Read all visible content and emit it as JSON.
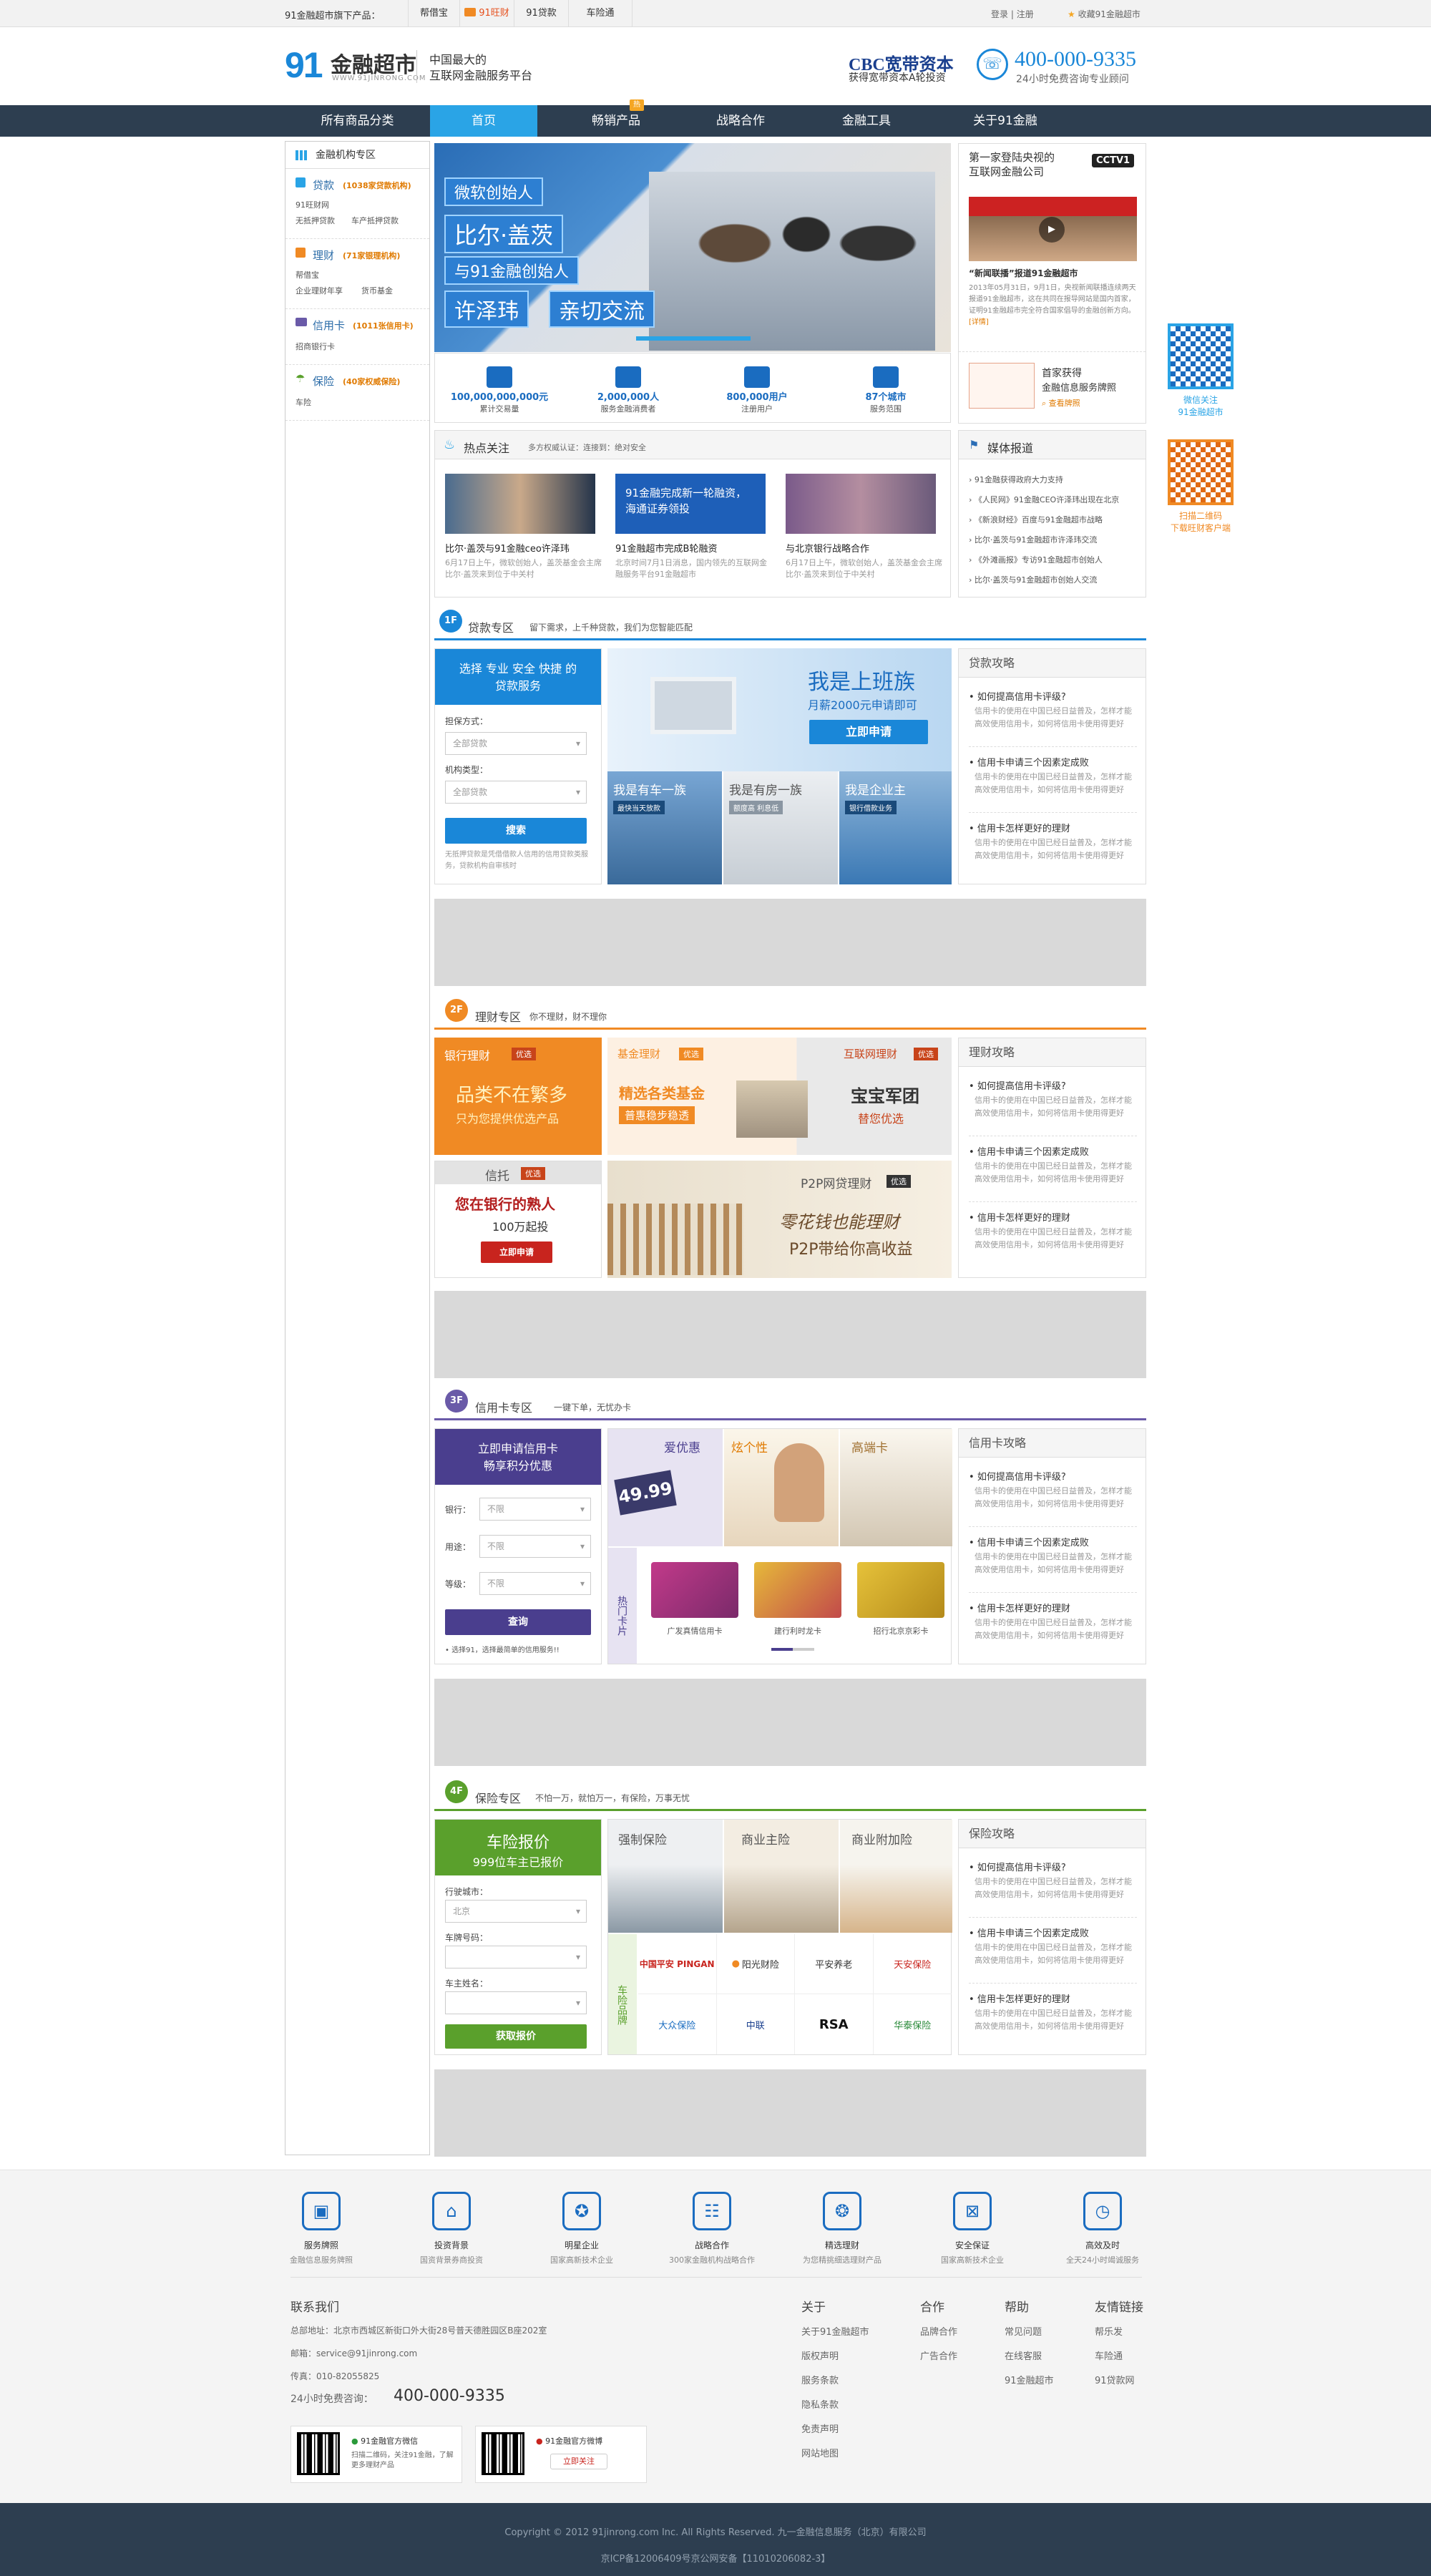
{
  "topbar": {
    "label": "91金融超市旗下产品：",
    "items": [
      "帮借宝",
      "91旺财",
      "91贷款",
      "车险通"
    ],
    "login": "登录",
    "sep": "|",
    "register": "注册",
    "fav": "收藏91金融超市"
  },
  "header": {
    "logo_num": "91",
    "logo_text": "金融超市",
    "logo_url": "WWW.91JINRONG.COM",
    "slogan_1": "中国最大的",
    "slogan_2": "互联网金融服务平台",
    "cbc": "CBC宽带资本",
    "cbc_sub": "获得宽带资本A轮投资",
    "phone": "400-000-9335",
    "phone_sub": "24小时免费咨询专业顾问"
  },
  "nav": {
    "items": [
      "所有商品分类",
      "首页",
      "畅销产品",
      "战略合作",
      "金融工具",
      "关于91金融"
    ],
    "hot_tag": "热"
  },
  "sidebar": {
    "title": "金融机构专区",
    "loan": {
      "title": "贷款",
      "note": "(1038家贷款机构)",
      "links": [
        "91旺财网",
        "无抵押贷款",
        "车产抵押贷款"
      ]
    },
    "finance": {
      "title": "理财",
      "note": "(71家银理机构)",
      "links": [
        "帮借宝",
        "企业理财年享",
        "货币基金"
      ]
    },
    "card": {
      "title": "信用卡",
      "note": "(1011张信用卡)",
      "links": [
        "招商银行卡"
      ]
    },
    "insurance": {
      "title": "保险",
      "note": "(40家权威保险)",
      "links": [
        "车险"
      ]
    }
  },
  "banner": {
    "l1": "微软创始人",
    "l2": "比尔·盖茨",
    "l3": "与91金融创始人",
    "l4": "许泽玮",
    "l5": "亲切交流"
  },
  "stats": [
    {
      "num": "100,000,000,000元",
      "lbl": "累计交易量"
    },
    {
      "num": "2,000,000人",
      "lbl": "服务金融消费者"
    },
    {
      "num": "800,000用户",
      "lbl": "注册用户"
    },
    {
      "num": "87个城市",
      "lbl": "服务范围"
    }
  ],
  "news_right": {
    "head1": "第一家登陆央视的",
    "head2": "互联网金融公司",
    "cctv": "CCTV1",
    "title": "“新闻联播”报道91金融超市",
    "body": "2013年05月31日，9月1日，央视新闻联播连续两天报道91金融超市，这在共同在报导网站是国内首家，证明91金融超市完全符合国家倡导的金融创新方向。",
    "more": "[详情]",
    "promo1": "首家获得",
    "promo2": "金融信息服务牌照",
    "promo_link": "查看牌照"
  },
  "hot": {
    "title": "热点关注",
    "tags": "多方权威认证：连接到：绝对安全",
    "cards": [
      {
        "t": "比尔·盖茨与91金融ceo许泽玮",
        "d": "6月17日上午，微软创始人，盖茨基金会主席比尔·盖茨来到位于中关村"
      },
      {
        "t": "91金融超市完成B轮融资",
        "d": "北京时间7月1日消息，国内领先的互联网金融服务平台91金融超市"
      },
      {
        "t": "与北京银行战略合作",
        "d": "6月17日上午，微软创始人，盖茨基金会主席比尔·盖茨来到位于中关村"
      }
    ],
    "card2_img": "91金融完成新一轮融资，海通证券领投"
  },
  "media": {
    "title": "媒体报道",
    "items": [
      "91金融获得政府大力支持",
      "《人民网》91金融CEO许泽玮出现在北京",
      "《新浪财经》百度与91金融超市战略",
      "比尔·盖茨与91金融超市许泽玮交流",
      "《外滩画报》专访91金融超市创始人",
      "比尔·盖茨与91金融超市创始人交流"
    ]
  },
  "floor1": {
    "badge": "1F",
    "title": "贷款专区",
    "sub": "留下需求，上千种贷款，我们为您智能匹配",
    "form": {
      "head1": "选择 专业 安全 快捷 的",
      "head2": "贷款服务",
      "l1": "担保方式：",
      "v1": "全部贷款",
      "l2": "机构类型：",
      "v2": "全部贷款",
      "btn": "搜索",
      "note": "无抵押贷款是凭借借款人信用的信用贷款类服务，贷款机构自审核时"
    },
    "promo": {
      "big": "我是上班族",
      "sub": "月薪2000元申请即可",
      "btn": "立即申请",
      "c1": "我是有车一族",
      "c1s": "最快当天放款",
      "c2": "我是有房一族",
      "c2s": "额度高 利息低",
      "c3": "我是企业主",
      "c3s": "银行借款业务"
    },
    "strat": {
      "title": "贷款攻略"
    }
  },
  "floor2": {
    "badge": "2F",
    "title": "理财专区",
    "sub": "你不理财，财不理你",
    "bank": {
      "title": "银行理财",
      "tag": "优选",
      "l1": "品类不在繁多",
      "l2": "只为您提供优选产品"
    },
    "fund": {
      "title": "基金理财",
      "tag": "优选",
      "l1": "精选各类基金",
      "l2": "普惠稳步稳透"
    },
    "net": {
      "title": "互联网理财",
      "tag": "优选",
      "l1": "宝宝军团",
      "l2": "替您优选"
    },
    "trust": {
      "title": "信托",
      "tag": "优选",
      "l1": "您在银行的熟人",
      "l2": "100万起投",
      "btn": "立即申请"
    },
    "p2p": {
      "title": "P2P网贷理财",
      "tag": "优选",
      "l1": "零花钱也能理财",
      "l2": "P2P带给你高收益"
    },
    "strat": {
      "title": "理财攻略"
    }
  },
  "floor3": {
    "badge": "3F",
    "title": "信用卡专区",
    "sub": "一键下单，无忧办卡",
    "form": {
      "head1": "立即申请信用卡",
      "head2": "畅享积分优惠",
      "l1": "银行：",
      "v1": "不限",
      "l2": "用途：",
      "v2": "不限",
      "l3": "等级：",
      "v3": "不限",
      "btn": "查询",
      "note": "选择91，选择最简单的信用服务!!"
    },
    "promo": {
      "t1": "爱优惠",
      "t2": "炫个性",
      "t3": "高端卡",
      "price": "49.99",
      "hot": "热门卡片",
      "cards": [
        "广发真情信用卡",
        "建行利时龙卡",
        "招行北京京彩卡"
      ]
    },
    "strat": {
      "title": "信用卡攻略"
    }
  },
  "floor4": {
    "badge": "4F",
    "title": "保险专区",
    "sub": "不怕一万，就怕万一，有保险，万事无忧",
    "form": {
      "head1": "车险报价",
      "head2": "999位车主已报价",
      "l1": "行驶城市：",
      "v1": "北京",
      "l2": "车牌号码：",
      "l3": "车主姓名：",
      "btn": "获取报价"
    },
    "promo": {
      "t1": "强制保险",
      "t2": "商业主险",
      "t3": "商业附加险",
      "brand": "车险品牌",
      "brands": [
        "中国平安 PINGAN",
        "阳光财险",
        "平安养老",
        "天安保险",
        "大众保险",
        "中联",
        "RSA",
        "华泰保险"
      ]
    },
    "strat": {
      "title": "保险攻略"
    }
  },
  "strategy_items": [
    {
      "q": "如何提高信用卡评级?",
      "a": "信用卡的使用在中国已经日益普及，怎样才能高效使用信用卡，如何将信用卡使用得更好"
    },
    {
      "q": "信用卡申请三个因素定成败",
      "a": "信用卡的使用在中国已经日益普及，怎样才能高效使用信用卡，如何将信用卡使用得更好"
    },
    {
      "q": "信用卡怎样更好的理财",
      "a": "信用卡的使用在中国已经日益普及，怎样才能高效使用信用卡，如何将信用卡使用得更好"
    }
  ],
  "footer": {
    "features": [
      {
        "t": "服务牌照",
        "s": "金融信息服务牌照"
      },
      {
        "t": "投资背景",
        "s": "国资背景券商投资"
      },
      {
        "t": "明星企业",
        "s": "国家高新技术企业"
      },
      {
        "t": "战略合作",
        "s": "300家金融机构战略合作"
      },
      {
        "t": "精选理财",
        "s": "为您精挑细选理财产品"
      },
      {
        "t": "安全保证",
        "s": "国家高新技术企业"
      },
      {
        "t": "高效及时",
        "s": "全天24小时竭诚服务"
      }
    ],
    "contact": {
      "title": "联系我们",
      "addr": "总部地址：北京市西城区新街口外大街28号普天德胜园区B座202室",
      "mail": "邮箱：service@91jinrong.com",
      "fax": "传真：010-82055825",
      "hot_lbl": "24小时免费咨询：",
      "hot": "400-000-9335",
      "wx1": "91金融官方微信",
      "wx2": "扫描二维码，关注91金融，了解更多理财产品",
      "wb1": "91金融官方微博",
      "wb_btn": "立即关注"
    },
    "cols": [
      {
        "h": "关于",
        "l": [
          "关于91金融超市",
          "版权声明",
          "服务条款",
          "隐私条款",
          "免责声明",
          "网站地图"
        ]
      },
      {
        "h": "合作",
        "l": [
          "品牌合作",
          "广告合作"
        ]
      },
      {
        "h": "帮助",
        "l": [
          "常见问题",
          "在线客服",
          "91金融超市"
        ]
      },
      {
        "h": "友情链接",
        "l": [
          "帮乐发",
          "车险通",
          "91贷款网"
        ]
      }
    ],
    "copyright": "Copyright © 2012 91jinrong.com Inc. All Rights Reserved. 九一金融信息服务（北京）有限公司",
    "icp": "京ICP备12006409号京公网安备【11010206082-3】"
  },
  "float_qr": {
    "q1": "微信关注",
    "q1b": "91金融超市",
    "q2": "扫描二维码",
    "q2b": "下载旺财客户端"
  }
}
